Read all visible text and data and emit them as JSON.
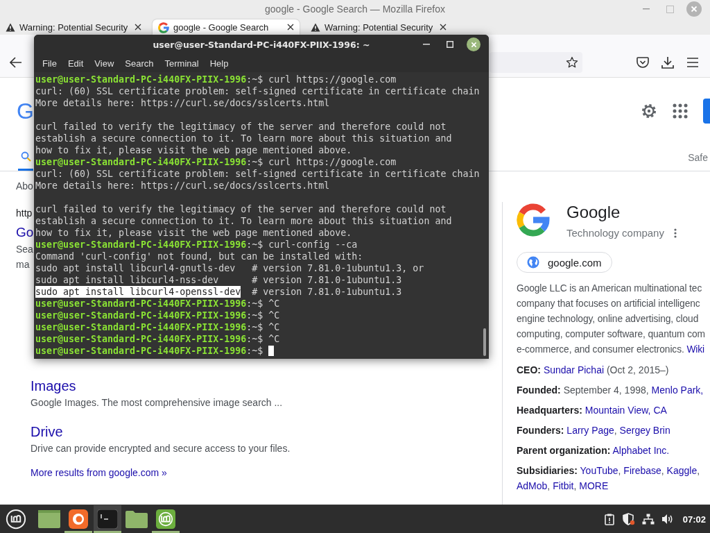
{
  "browser": {
    "title": "google - Google Search — Mozilla Firefox",
    "tabs": [
      {
        "kind": "warning",
        "label": "Warning: Potential Security",
        "selected": false
      },
      {
        "kind": "google",
        "label": "google - Google Search",
        "selected": true
      },
      {
        "kind": "warning",
        "label": "Warning: Potential Security",
        "selected": false
      }
    ],
    "page": {
      "logo_fragment": "G",
      "safe_fragment": "Safe",
      "fragments": [
        {
          "kind": "snippet",
          "text": "Abo"
        },
        {
          "kind": "url",
          "text": "http"
        },
        {
          "kind": "title",
          "text": "Go"
        },
        {
          "kind": "snippet",
          "text": "Sea"
        },
        {
          "kind": "snippet",
          "text": "ma"
        }
      ],
      "results": [
        {
          "title": "Images",
          "snippet": "Google Images. The most comprehensive image search ..."
        },
        {
          "title": "Drive",
          "snippet": "Drive can provide encrypted and secure access to your files."
        }
      ],
      "more_link": "More results from google.com »",
      "knowledge_panel": {
        "name": "Google",
        "type": "Technology company",
        "site": "google.com",
        "description_lines": [
          "Google LLC is an American multinational tec",
          "company that focuses on artificial intelligenc",
          "engine technology, online advertising, cloud",
          "computing, computer software, quantum com",
          "e-commerce, and consumer electronics."
        ],
        "description_link": "Wiki",
        "facts": [
          {
            "label": "CEO:",
            "lines": [
              [
                {
                  "text": "Sundar Pichai",
                  "link": true
                },
                {
                  "text": " (Oct 2, 2015–)",
                  "link": false
                }
              ]
            ]
          },
          {
            "label": "Founded:",
            "lines": [
              [
                {
                  "text": "September 4, 1998, ",
                  "link": false
                },
                {
                  "text": "Menlo Park,",
                  "link": true
                }
              ]
            ]
          },
          {
            "label": "Headquarters:",
            "lines": [
              [
                {
                  "text": "Mountain View, CA",
                  "link": true
                }
              ]
            ]
          },
          {
            "label": "Founders:",
            "lines": [
              [
                {
                  "text": "Larry Page",
                  "link": true
                },
                {
                  "text": ", ",
                  "link": false
                },
                {
                  "text": "Sergey Brin",
                  "link": true
                }
              ]
            ]
          },
          {
            "label": "Parent organization:",
            "lines": [
              [
                {
                  "text": "Alphabet Inc.",
                  "link": true
                }
              ]
            ]
          },
          {
            "label": "Subsidiaries:",
            "lines": [
              [
                {
                  "text": "YouTube",
                  "link": true
                },
                {
                  "text": ", ",
                  "link": false
                },
                {
                  "text": "Firebase",
                  "link": true
                },
                {
                  "text": ", ",
                  "link": false
                },
                {
                  "text": "Kaggle",
                  "link": true
                },
                {
                  "text": ",",
                  "link": false
                }
              ],
              [
                {
                  "text": "AdMob",
                  "link": true
                },
                {
                  "text": ", ",
                  "link": false
                },
                {
                  "text": "Fitbit",
                  "link": true
                },
                {
                  "text": ", ",
                  "link": false
                },
                {
                  "text": "MORE",
                  "link": true
                }
              ]
            ]
          }
        ]
      }
    }
  },
  "terminal": {
    "title": "user@user-Standard-PC-i440FX-PIIX-1996: ~",
    "menu": [
      "File",
      "Edit",
      "View",
      "Search",
      "Terminal",
      "Help"
    ],
    "lines": [
      {
        "kind": "prompt",
        "user": "user@user-Standard-PC-i440FX-PIIX-1996",
        "path": ":~$",
        "command": "curl https://google.com"
      },
      {
        "kind": "output",
        "text": "curl: (60) SSL certificate problem: self-signed certificate in certificate chain"
      },
      {
        "kind": "output",
        "text": "More details here: https://curl.se/docs/sslcerts.html"
      },
      {
        "kind": "blank"
      },
      {
        "kind": "output",
        "text": "curl failed to verify the legitimacy of the server and therefore could not"
      },
      {
        "kind": "output",
        "text": "establish a secure connection to it. To learn more about this situation and"
      },
      {
        "kind": "output",
        "text": "how to fix it, please visit the web page mentioned above."
      },
      {
        "kind": "prompt",
        "user": "user@user-Standard-PC-i440FX-PIIX-1996",
        "path": ":~$",
        "command": "curl https://google.com"
      },
      {
        "kind": "output",
        "text": "curl: (60) SSL certificate problem: self-signed certificate in certificate chain"
      },
      {
        "kind": "output",
        "text": "More details here: https://curl.se/docs/sslcerts.html"
      },
      {
        "kind": "blank"
      },
      {
        "kind": "output",
        "text": "curl failed to verify the legitimacy of the server and therefore could not"
      },
      {
        "kind": "output",
        "text": "establish a secure connection to it. To learn more about this situation and"
      },
      {
        "kind": "output",
        "text": "how to fix it, please visit the web page mentioned above."
      },
      {
        "kind": "prompt",
        "user": "user@user-Standard-PC-i440FX-PIIX-1996",
        "path": ":~$",
        "command": "curl-config --ca"
      },
      {
        "kind": "output",
        "text": "Command 'curl-config' not found, but can be installed with:"
      },
      {
        "kind": "output",
        "text": "sudo apt install libcurl4-gnutls-dev   # version 7.81.0-1ubuntu1.3, or"
      },
      {
        "kind": "output",
        "text": "sudo apt install libcurl4-nss-dev      # version 7.81.0-1ubuntu1.3"
      },
      {
        "kind": "selection",
        "highlight": "sudo apt install libcurl4-openssl-dev",
        "text": "  # version 7.81.0-1ubuntu1.3"
      },
      {
        "kind": "prompt",
        "user": "user@user-Standard-PC-i440FX-PIIX-1996",
        "path": ":~$",
        "command": "^C"
      },
      {
        "kind": "prompt",
        "user": "user@user-Standard-PC-i440FX-PIIX-1996",
        "path": ":~$",
        "command": "^C"
      },
      {
        "kind": "prompt",
        "user": "user@user-Standard-PC-i440FX-PIIX-1996",
        "path": ":~$",
        "command": "^C"
      },
      {
        "kind": "prompt",
        "user": "user@user-Standard-PC-i440FX-PIIX-1996",
        "path": ":~$",
        "command": "^C"
      },
      {
        "kind": "prompt",
        "user": "user@user-Standard-PC-i440FX-PIIX-1996",
        "path": ":~$",
        "cursor": true
      }
    ]
  },
  "taskbar": {
    "items": [
      {
        "kind": "menu",
        "running": false,
        "selected": false
      },
      {
        "kind": "desktop",
        "running": false,
        "selected": false
      },
      {
        "kind": "browser",
        "running": true,
        "selected": false
      },
      {
        "kind": "terminal",
        "running": true,
        "selected": true
      },
      {
        "kind": "files",
        "running": false,
        "selected": false
      },
      {
        "kind": "update",
        "running": true,
        "selected": false
      }
    ],
    "clock": "07:02"
  }
}
